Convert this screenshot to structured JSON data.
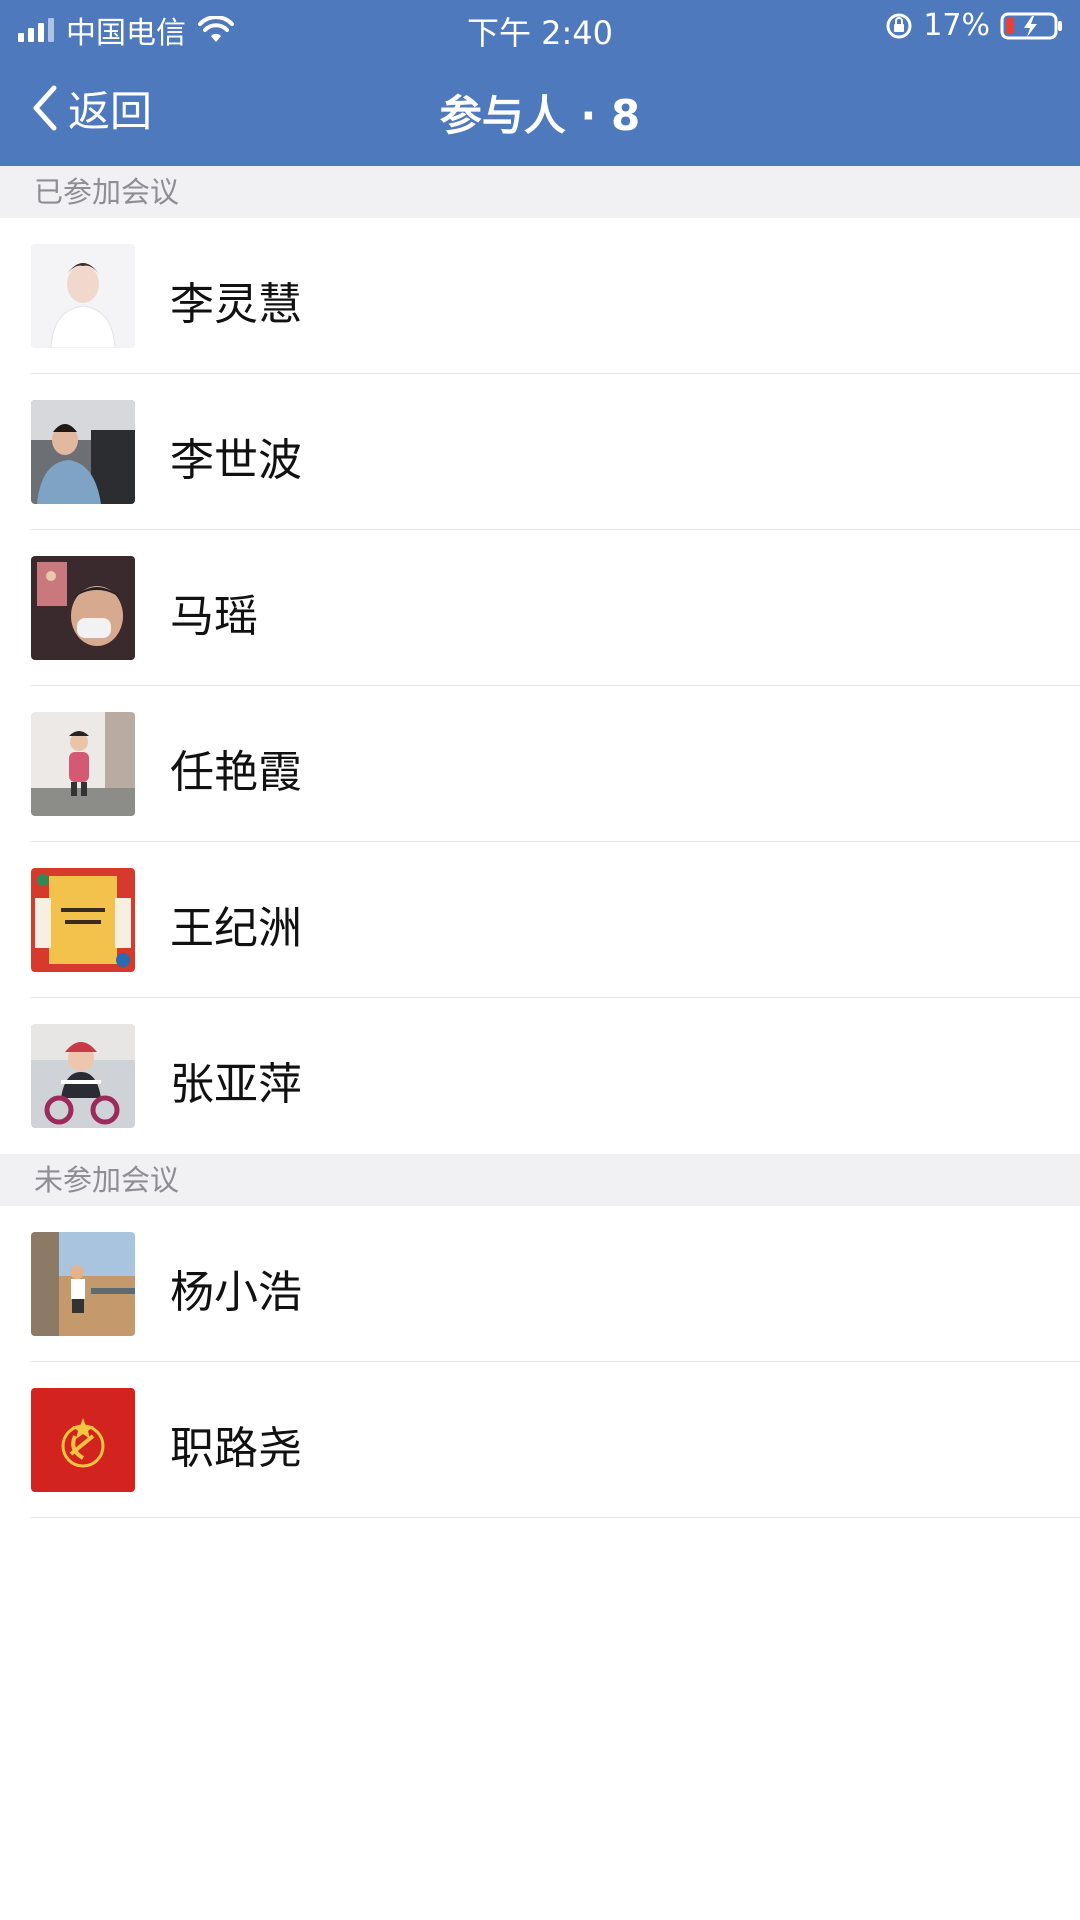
{
  "status_bar": {
    "carrier": "中国电信",
    "time": "下午 2:40",
    "battery": "17%",
    "icons": [
      "signal-icon",
      "wifi-icon",
      "orientation-lock-icon",
      "battery-charging-icon"
    ]
  },
  "nav": {
    "back_label": "返回",
    "title": "参与人 · 8",
    "colors": {
      "bar": "#4f79bd",
      "text": "#ffffff"
    }
  },
  "sections": [
    {
      "header": "已参加会议",
      "people": [
        {
          "name": "李灵慧",
          "avatar": "avatar-photo-woman-white"
        },
        {
          "name": "李世波",
          "avatar": "avatar-photo-man-car"
        },
        {
          "name": "马瑶",
          "avatar": "avatar-photo-mask"
        },
        {
          "name": "任艳霞",
          "avatar": "avatar-photo-child-room"
        },
        {
          "name": "王纪洲",
          "avatar": "avatar-art-red-yellow"
        },
        {
          "name": "张亚萍",
          "avatar": "avatar-photo-child-bike"
        }
      ]
    },
    {
      "header": "未参加会议",
      "people": [
        {
          "name": "杨小浩",
          "avatar": "avatar-photo-beach"
        },
        {
          "name": "职路尧",
          "avatar": "avatar-red-emblem"
        }
      ]
    }
  ]
}
